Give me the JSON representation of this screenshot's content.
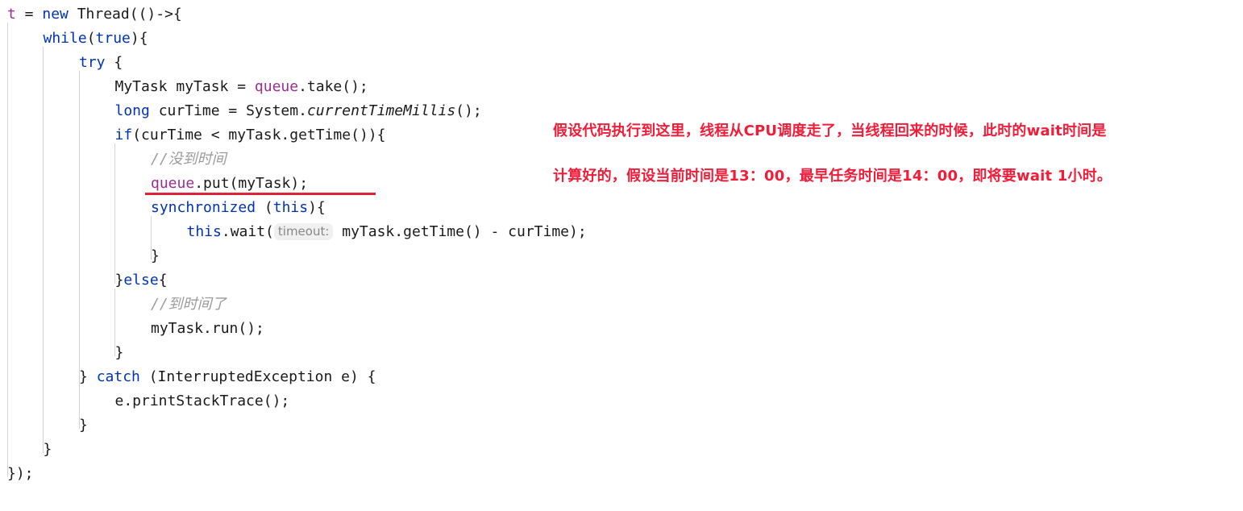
{
  "editor": {
    "language": "java",
    "background_color": "#ffffff",
    "indent_guide_color": "#d3d3d3",
    "keyword_color": "#0033b3",
    "field_color": "#9b2d8e",
    "comment_color": "#9a9a9a",
    "text_color": "#1a1a1a",
    "annotation_color": "#f01c38",
    "underline_color": "#e02437",
    "param_hint_bg": "#f0f0f0",
    "param_hint_color": "#878787"
  },
  "code": {
    "lines": [
      {
        "indent": 0,
        "tokens": [
          {
            "t": "t",
            "c": "field"
          },
          {
            "t": " = ",
            "c": "plain"
          },
          {
            "t": "new",
            "c": "kw"
          },
          {
            "t": " Thread(()->{",
            "c": "plain"
          }
        ]
      },
      {
        "indent": 1,
        "tokens": [
          {
            "t": "while",
            "c": "kw"
          },
          {
            "t": "(",
            "c": "plain"
          },
          {
            "t": "true",
            "c": "kw"
          },
          {
            "t": "){",
            "c": "plain"
          }
        ]
      },
      {
        "indent": 2,
        "tokens": [
          {
            "t": "try",
            "c": "kw"
          },
          {
            "t": " {",
            "c": "plain"
          }
        ]
      },
      {
        "indent": 3,
        "tokens": [
          {
            "t": "MyTask myTask = ",
            "c": "plain"
          },
          {
            "t": "queue",
            "c": "field"
          },
          {
            "t": ".take();",
            "c": "plain"
          }
        ]
      },
      {
        "indent": 3,
        "tokens": [
          {
            "t": "long",
            "c": "kw"
          },
          {
            "t": " curTime = System.",
            "c": "plain"
          },
          {
            "t": "currentTimeMillis",
            "c": "stat"
          },
          {
            "t": "();",
            "c": "plain"
          }
        ]
      },
      {
        "indent": 3,
        "tokens": [
          {
            "t": "if",
            "c": "kw"
          },
          {
            "t": "(curTime < myTask.getTime()){",
            "c": "plain"
          }
        ]
      },
      {
        "indent": 4,
        "tokens": [
          {
            "t": "//没到时间",
            "c": "cmt"
          }
        ]
      },
      {
        "indent": 4,
        "tokens": [
          {
            "t": "queue",
            "c": "field"
          },
          {
            "t": ".put(myTask);",
            "c": "plain"
          }
        ]
      },
      {
        "indent": 4,
        "tokens": [
          {
            "t": "synchronized",
            "c": "kw"
          },
          {
            "t": " (",
            "c": "plain"
          },
          {
            "t": "this",
            "c": "kw"
          },
          {
            "t": "){",
            "c": "plain"
          }
        ]
      },
      {
        "indent": 5,
        "tokens": [
          {
            "t": "this",
            "c": "kw"
          },
          {
            "t": ".wait(",
            "c": "plain"
          },
          {
            "t": "timeout:",
            "c": "hint"
          },
          {
            "t": "myTask.getTime() - curTime);",
            "c": "plain"
          }
        ]
      },
      {
        "indent": 4,
        "tokens": [
          {
            "t": "}",
            "c": "brace"
          }
        ]
      },
      {
        "indent": 3,
        "tokens": [
          {
            "t": "}",
            "c": "brace"
          },
          {
            "t": "else",
            "c": "kw"
          },
          {
            "t": "{",
            "c": "brace"
          }
        ]
      },
      {
        "indent": 4,
        "tokens": [
          {
            "t": "//到时间了",
            "c": "cmt"
          }
        ]
      },
      {
        "indent": 4,
        "tokens": [
          {
            "t": "myTask.run();",
            "c": "plain"
          }
        ]
      },
      {
        "indent": 3,
        "tokens": [
          {
            "t": "}",
            "c": "brace"
          }
        ]
      },
      {
        "indent": 2,
        "tokens": [
          {
            "t": "} ",
            "c": "brace"
          },
          {
            "t": "catch",
            "c": "kw"
          },
          {
            "t": " (InterruptedException e) {",
            "c": "plain"
          }
        ]
      },
      {
        "indent": 3,
        "tokens": [
          {
            "t": "e.printStackTrace();",
            "c": "plain"
          }
        ]
      },
      {
        "indent": 2,
        "tokens": [
          {
            "t": "}",
            "c": "brace"
          }
        ]
      },
      {
        "indent": 1,
        "tokens": [
          {
            "t": "}",
            "c": "brace"
          }
        ]
      },
      {
        "indent": 0,
        "tokens": [
          {
            "t": "});",
            "c": "plain"
          }
        ]
      }
    ]
  },
  "annotation": {
    "line1": "假设代码执行到这里，线程从CPU调度走了，当线程回来的时候，此时的wait时间是",
    "line2": "计算好的，假设当前时间是13：00，最早任务时间是14：00，即将要wait 1小时。"
  },
  "highlight": {
    "underlined_statement": "queue.put(myTask);"
  }
}
